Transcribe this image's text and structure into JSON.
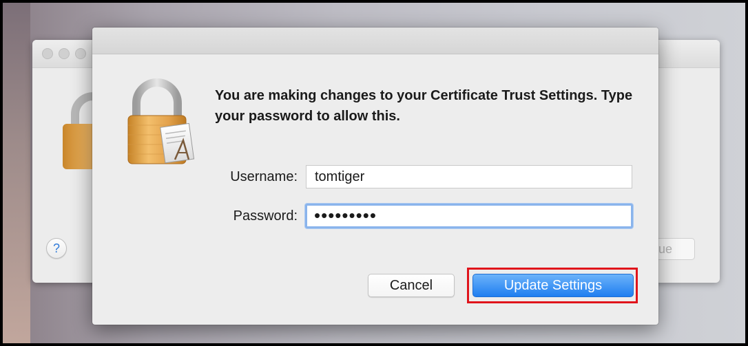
{
  "background_window": {
    "help_label": "?",
    "button_partial_label": "ue"
  },
  "dialog": {
    "message": "You are making changes to your Certificate Trust Settings. Type your password to allow this.",
    "username_label": "Username:",
    "username_value": "tomtiger",
    "password_label": "Password:",
    "password_value": "•••••••••",
    "cancel_label": "Cancel",
    "primary_label": "Update Settings"
  },
  "colors": {
    "primary_button": "#1f7ef0",
    "focus_ring": "#8ab4ec",
    "annotation_box": "#e0141b",
    "help_icon": "#2f7ad9"
  },
  "icons": {
    "lock": "padlock-with-certificate-icon",
    "help": "question-mark-icon"
  }
}
